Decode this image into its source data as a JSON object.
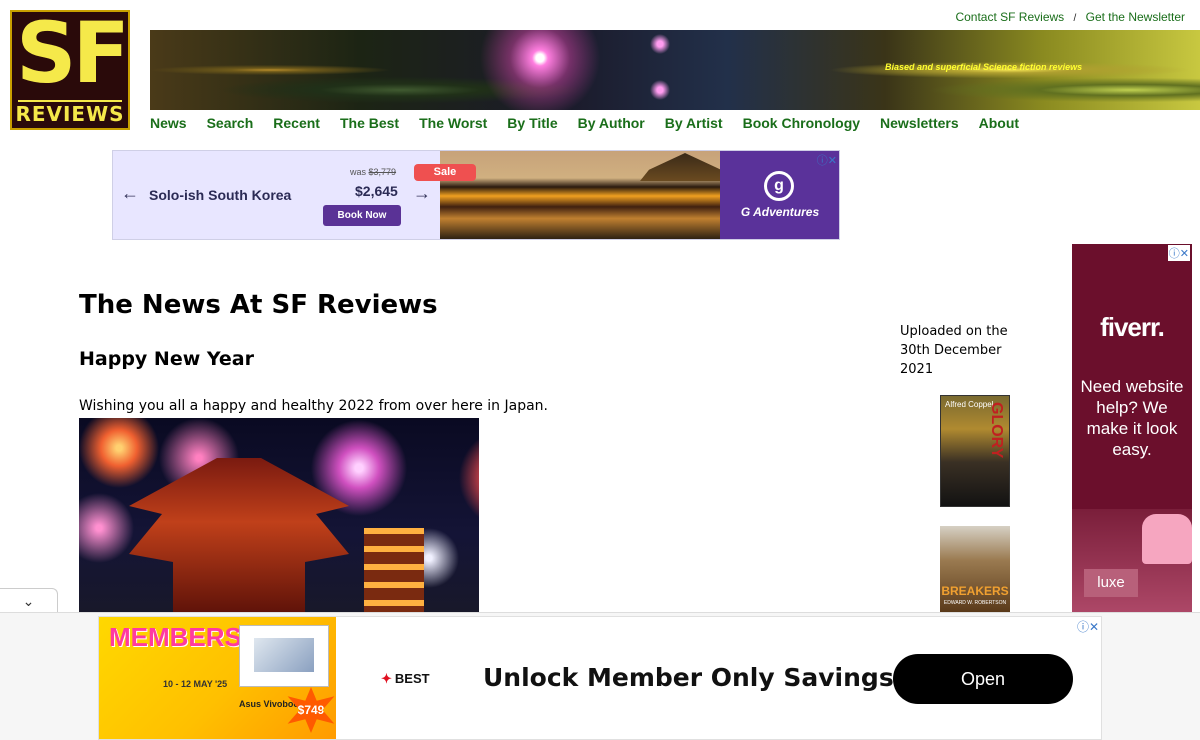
{
  "header": {
    "logo_top": "SF",
    "logo_bottom": "REVIEWS",
    "tagline": "Biased and superficial Science fiction reviews",
    "contact_link": "Contact SF Reviews",
    "separator": "/",
    "newsletter_link": "Get the Newsletter"
  },
  "nav": {
    "items": [
      "News",
      "Search",
      "Recent",
      "The Best",
      "The Worst",
      "By Title",
      "By Author",
      "By Artist",
      "Book Chronology",
      "Newsletters",
      "About"
    ]
  },
  "top_ad": {
    "title": "Solo-ish South Korea",
    "was_label": "was",
    "was_price": "$3,779",
    "price": "$2,645",
    "book_button": "Book Now",
    "sale_badge": "Sale",
    "brand_letter": "g",
    "brand": "G Adventures",
    "close": "ⓘ✕"
  },
  "side_ad": {
    "brand": "fiverr.",
    "message": "Need website help? We make it look easy.",
    "luxe": "luxe",
    "close": "ⓘ✕"
  },
  "main": {
    "page_title": "The News At SF Reviews",
    "post_title": "Happy New Year",
    "post_text": "Wishing you all a happy and healthy 2022 from over here in Japan."
  },
  "sidebar": {
    "uploaded": "Uploaded on the 30th December 2021",
    "book1_title": "GLORY",
    "book1_author": "Alfred Coppel",
    "book2_title": "BREAKERS",
    "book2_author": "EDWARD W. ROBERTSON"
  },
  "bottom_ad": {
    "collapse": "⌄",
    "promo": "MEMBERS SALE",
    "dates": "10 - 12 MAY '25",
    "laptop_text": "Asus Vivobook",
    "price_star": "$749",
    "brand": "BEST",
    "headline": "Unlock Member Only Savings",
    "open_button": "Open",
    "close": "ⓘ✕"
  },
  "colors": {
    "nav_green": "#1a6e1a",
    "logo_yellow": "#f5e94a",
    "g_adventures_purple": "#5a329a",
    "fiverr_red": "#6b0f2c"
  }
}
